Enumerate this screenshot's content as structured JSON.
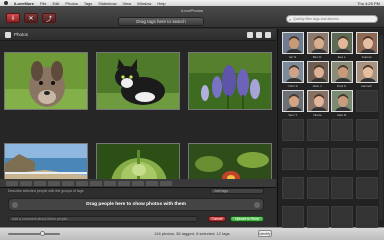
{
  "menubar": {
    "app_name": "iLoveMore",
    "items": [
      "File",
      "Edit",
      "Photos",
      "Tags",
      "Slideshow",
      "View",
      "Window",
      "Help"
    ],
    "clock": "Thu 4:25 PM"
  },
  "toolbar": {
    "window_title": "iLovePhotos",
    "tag_drop_label": "Drag tags here to search",
    "search_placeholder": "Quickly filter tags and albums"
  },
  "photos_pane": {
    "title": "Photos",
    "icon_names": [
      "photo-icon",
      "list-view-icon",
      "trash-icon",
      "grid-view-icon"
    ]
  },
  "photos": [
    {
      "name": "photo-dog-on-grass",
      "colors": [
        "#5f8f2f",
        "#9bb15f",
        "#7d6a55"
      ]
    },
    {
      "name": "photo-black-white-cat",
      "colors": [
        "#557d2e",
        "#1c1c1c",
        "#efefef"
      ]
    },
    {
      "name": "photo-purple-flowers",
      "colors": [
        "#3b6a20",
        "#6b5fb1",
        "#a8a6d9"
      ]
    },
    {
      "name": "photo-coastline",
      "colors": [
        "#6d9fcf",
        "#8b7b5e",
        "#d6c3a3"
      ]
    },
    {
      "name": "photo-green-plant",
      "colors": [
        "#2f5b17",
        "#7ea640",
        "#c0d580"
      ]
    },
    {
      "name": "photo-red-flower",
      "colors": [
        "#2f4d1a",
        "#6a8f32",
        "#c2422a"
      ]
    }
  ],
  "people_area": {
    "hint": "Describe selected people with the groups of tags",
    "select_value": "Joel tags",
    "drop_label": "Drag people here to show photos with them",
    "comment_placeholder": "Add a comment about these people...",
    "cancel_label": "Cancel",
    "upload_label": "Upload to Story"
  },
  "status": {
    "summary": "116 photos, 38 tagged, 8 selected, 12 tags",
    "button_label": "Identify"
  },
  "people": [
    {
      "name": "Ian S.",
      "skin": "#c89a78",
      "bg": "#6f7c8f"
    },
    {
      "name": "Ben D.",
      "skin": "#d9ad8d",
      "bg": "#8a7a6e"
    },
    {
      "name": "Eva L.",
      "skin": "#e2b79a",
      "bg": "#5d6a55"
    },
    {
      "name": "Joanna",
      "skin": "#e6bea3",
      "bg": "#8e6a55"
    },
    {
      "name": "Chris S.",
      "skin": "#cfa286",
      "bg": "#7c8b9b"
    },
    {
      "name": "Alice J.",
      "skin": "#dcb094",
      "bg": "#6e5e52"
    },
    {
      "name": "Paul K.",
      "skin": "#c99a7a",
      "bg": "#8b8b7a"
    },
    {
      "name": "Hannah",
      "skin": "#e5bda1",
      "bg": "#a8927d"
    },
    {
      "name": "Sam T.",
      "skin": "#d3a584",
      "bg": "#6c6f75"
    },
    {
      "name": "Nicole",
      "skin": "#e1b59b",
      "bg": "#877064"
    },
    {
      "name": "Jake R.",
      "skin": "#c89c7d",
      "bg": "#7b8a72"
    }
  ]
}
